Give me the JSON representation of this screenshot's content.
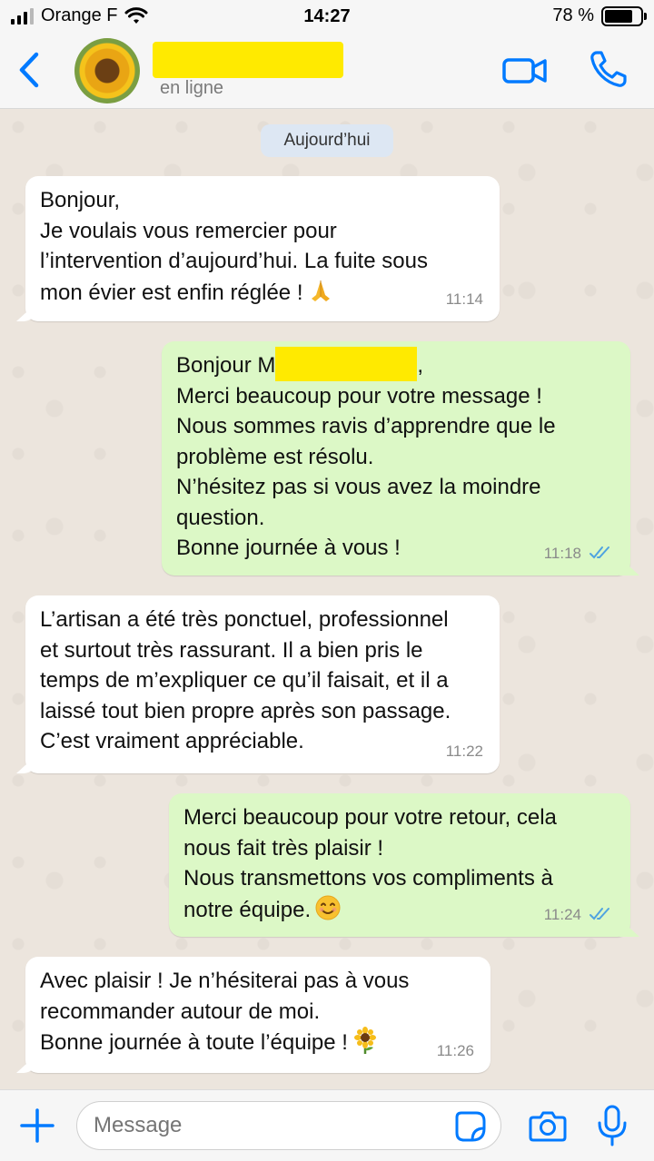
{
  "status_bar": {
    "carrier": "Orange F",
    "time": "14:27",
    "battery_percent": "78 %",
    "battery_level": 0.78
  },
  "header": {
    "presence": "en ligne"
  },
  "chat": {
    "date_chip": "Aujourd’hui",
    "messages": [
      {
        "direction": "in",
        "lines": [
          "Bonjour,",
          "Je voulais vous remercier pour",
          "l’intervention d’aujourd’hui. La fuite sous",
          "mon évier est enfin réglée !"
        ],
        "emoji": "folded-hands",
        "time": "11:14"
      },
      {
        "direction": "out",
        "greeting_prefix": "Bonjour M",
        "greeting_suffix": ",",
        "lines": [
          "Merci beaucoup pour votre message !",
          "Nous sommes ravis d’apprendre que le",
          "problème est résolu.",
          "N’hésitez pas si vous avez la moindre",
          "question.",
          "Bonne journée à vous !"
        ],
        "time": "11:18",
        "status": "read"
      },
      {
        "direction": "in",
        "lines": [
          "L’artisan a été très ponctuel, professionnel",
          "et surtout très rassurant. Il a bien pris le",
          "temps de m’expliquer ce qu’il faisait, et il a",
          "laissé tout bien propre après son passage.",
          "C’est vraiment appréciable."
        ],
        "time": "11:22"
      },
      {
        "direction": "out",
        "lines": [
          "Merci beaucoup pour votre retour, cela",
          "nous fait très plaisir !",
          "Nous transmettons vos compliments à",
          "notre équipe."
        ],
        "emoji": "smiling-face",
        "time": "11:24",
        "status": "read"
      },
      {
        "direction": "in",
        "lines": [
          "Avec plaisir ! Je n’hésiterai pas à vous",
          "recommander autour de moi.",
          "Bonne journée à toute l’équipe !"
        ],
        "emoji": "sunflower",
        "time": "11:26"
      }
    ]
  },
  "input": {
    "placeholder": "Message"
  },
  "colors": {
    "accent": "#007aff",
    "read_ticks": "#4fa3e0",
    "out_bubble": "#dcf8c6",
    "in_bubble": "#ffffff",
    "redaction": "#ffea00"
  }
}
